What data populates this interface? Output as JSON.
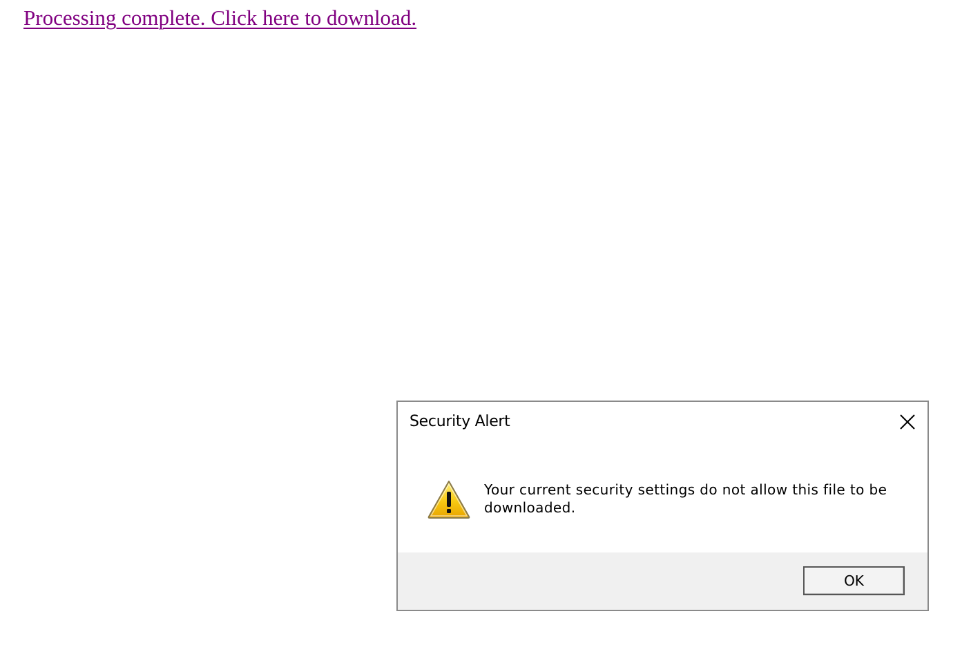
{
  "page": {
    "link_text": "Processing complete. Click here to download.",
    "link_color": "#800080"
  },
  "dialog": {
    "title": "Security Alert",
    "close_icon": "close-icon",
    "warning_icon": "warning-icon",
    "message": "Your current security settings do not allow this file to be downloaded.",
    "ok_label": "OK",
    "footer_color": "#f0f0f0"
  }
}
